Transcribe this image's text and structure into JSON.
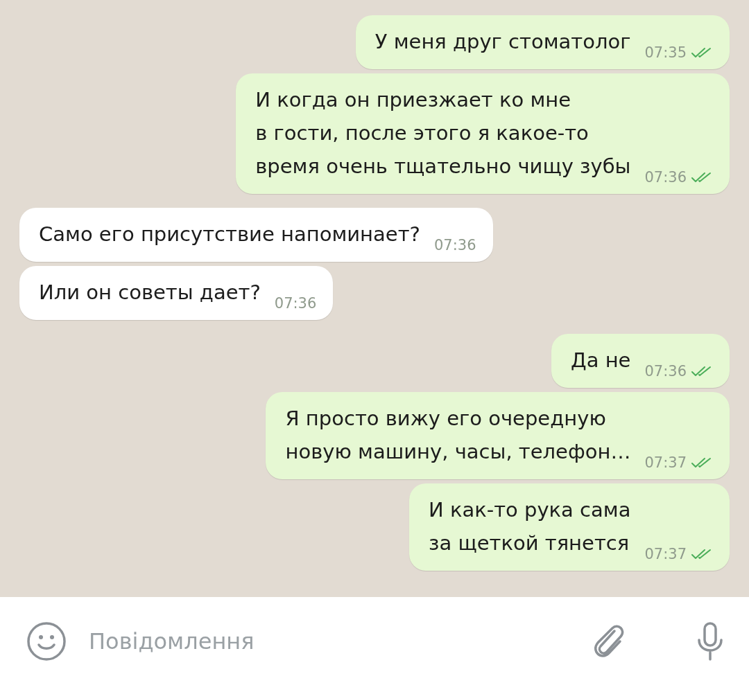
{
  "messages": [
    {
      "kind": "outgoing",
      "text": "У меня друг стоматолог",
      "time": "07:35",
      "read": true
    },
    {
      "kind": "outgoing",
      "text": "И когда он приезжает ко мне\nв гости, после этого я какое-то\nвремя очень тщательно чищу зубы",
      "time": "07:36",
      "read": true
    },
    {
      "kind": "incoming",
      "text": "Само его присутствие напоминает?",
      "time": "07:36"
    },
    {
      "kind": "incoming",
      "text": "Или он советы дает?",
      "time": "07:36"
    },
    {
      "kind": "outgoing",
      "text": "Да не",
      "time": "07:36",
      "read": true
    },
    {
      "kind": "outgoing",
      "text": "Я просто вижу его очередную\nновую машину, часы, телефон…",
      "time": "07:37",
      "read": true
    },
    {
      "kind": "outgoing",
      "text": "И как-то рука сама\nза щеткой тянется",
      "time": "07:37",
      "read": true
    }
  ],
  "input": {
    "placeholder": "Повідомлення"
  }
}
